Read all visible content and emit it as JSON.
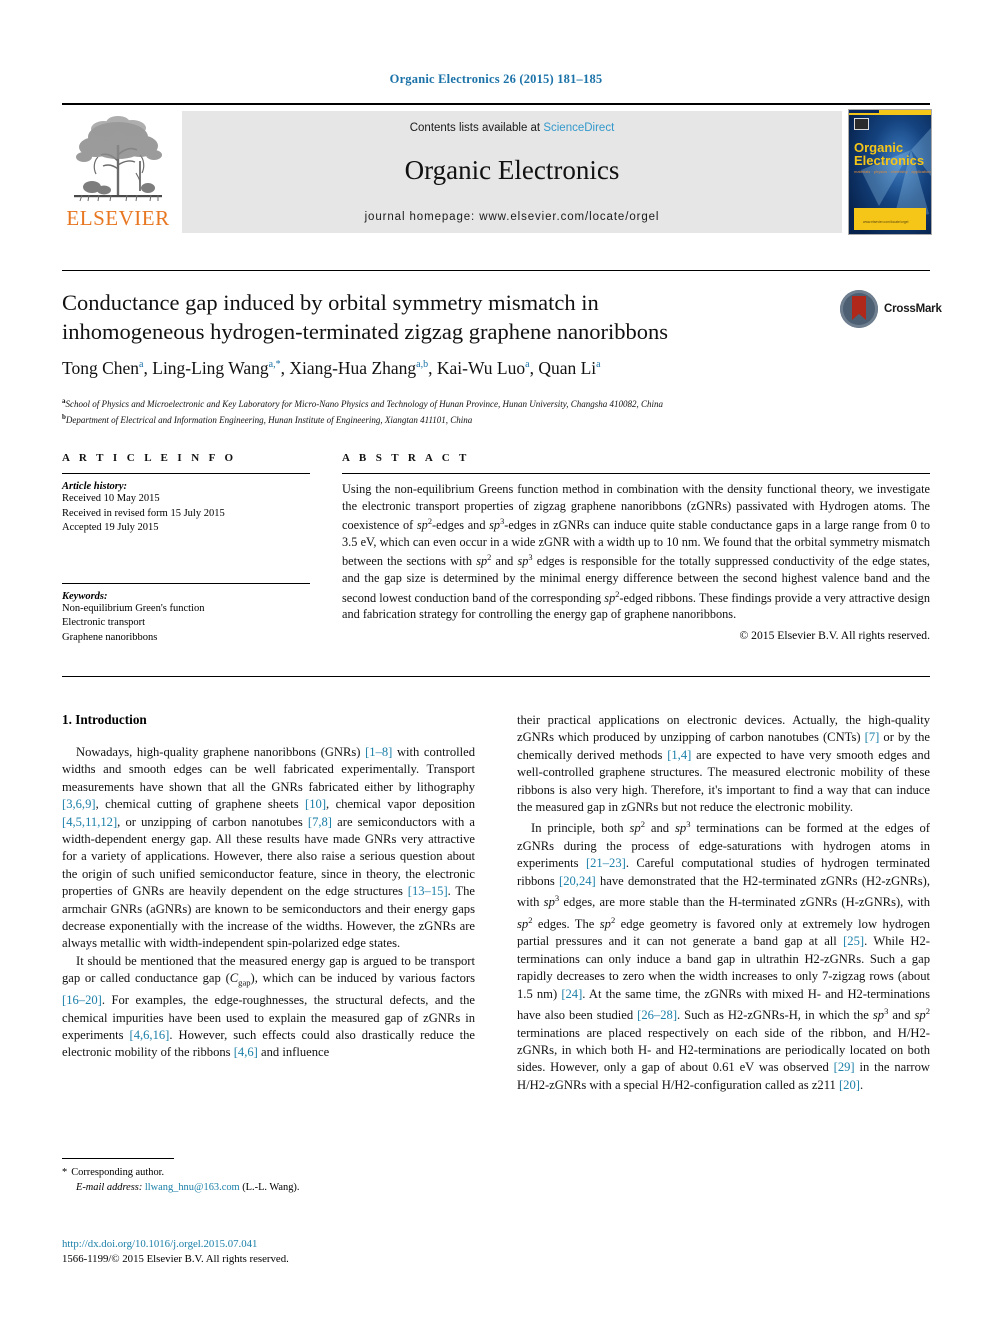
{
  "running_head": "Organic Electronics 26 (2015) 181–185",
  "journal_header": {
    "contents_prefix": "Contents lists available at ",
    "sciencedirect": "ScienceDirect",
    "journal_title": "Organic Electronics",
    "homepage": "journal homepage: www.elsevier.com/locate/orgel",
    "publisher_logo_text": "ELSEVIER",
    "cover_title_line1": "Organic",
    "cover_title_line2": "Electronics",
    "cover_subtitle": "materials • physics • chemistry • applications"
  },
  "crossmark": {
    "label": "CrossMark"
  },
  "article": {
    "title_line1": "Conductance gap induced by orbital symmetry mismatch in",
    "title_line2": "inhomogeneous hydrogen-terminated zigzag graphene nanoribbons",
    "authors": [
      {
        "name": "Tong Chen",
        "marks": "a"
      },
      {
        "name": "Ling-Ling Wang",
        "marks": "a,*"
      },
      {
        "name": "Xiang-Hua Zhang",
        "marks": "a,b"
      },
      {
        "name": "Kai-Wu Luo",
        "marks": "a"
      },
      {
        "name": "Quan Li",
        "marks": "a"
      }
    ],
    "affiliations": [
      {
        "mark": "a",
        "text": "School of Physics and Microelectronic and Key Laboratory for Micro-Nano Physics and Technology of Hunan Province, Hunan University, Changsha 410082, China"
      },
      {
        "mark": "b",
        "text": "Department of Electrical and Information Engineering, Hunan Institute of Engineering, Xiangtan 411101, China"
      }
    ]
  },
  "article_info": {
    "heading": "A R T I C L E   I N F O",
    "history_label": "Article history:",
    "history": [
      "Received 10 May 2015",
      "Received in revised form 15 July 2015",
      "Accepted 19 July 2015"
    ],
    "keywords_label": "Keywords:",
    "keywords": [
      "Non-equilibrium Green's function",
      "Electronic transport",
      "Graphene nanoribbons"
    ]
  },
  "abstract": {
    "heading": "A B S T R A C T",
    "text": "Using the non-equilibrium Greens function method in combination with the density functional theory, we investigate the electronic transport properties of zigzag graphene nanoribbons (zGNRs) passivated with Hydrogen atoms. The coexistence of sp2-edges and sp3-edges in zGNRs can induce quite stable conductance gaps in a large range from 0 to 3.5 eV, which can even occur in a wide zGNR with a width up to 10 nm. We found that the orbital symmetry mismatch between the sections with sp2 and sp3 edges is responsible for the totally suppressed conductivity of the edge states, and the gap size is determined by the minimal energy difference between the second highest valence band and the second lowest conduction band of the corresponding sp2-edged ribbons. These findings provide a very attractive design and fabrication strategy for controlling the energy gap of graphene nanoribbons.",
    "copyright": "© 2015 Elsevier B.V. All rights reserved."
  },
  "body": {
    "section_heading": "1. Introduction",
    "left_paragraphs": [
      "Nowadays, high-quality graphene nanoribbons (GNRs) [1–8] with controlled widths and smooth edges can be well fabricated experimentally. Transport measurements have shown that all the GNRs fabricated either by lithography [3,6,9], chemical cutting of graphene sheets [10], chemical vapor deposition [4,5,11,12], or unzipping of carbon nanotubes [7,8] are semiconductors with a width-dependent energy gap. All these results have made GNRs very attractive for a variety of applications. However, there also raise a serious question about the origin of such unified semiconductor feature, since in theory, the electronic properties of GNRs are heavily dependent on the edge structures [13–15]. The armchair GNRs (aGNRs) are known to be semiconductors and their energy gaps decrease exponentially with the increase of the widths. However, the zGNRs are always metallic with width-independent spin-polarized edge states.",
      "It should be mentioned that the measured energy gap is argued to be transport gap or called conductance gap (Cgap), which can be induced by various factors [16–20]. For examples, the edge-roughnesses, the structural defects, and the chemical impurities have been used to explain the measured gap of zGNRs in experiments [4,6,16]. However, such effects could also drastically reduce the electronic mobility of the ribbons [4,6] and influence"
    ],
    "right_paragraphs": [
      "their practical applications on electronic devices. Actually, the high-quality zGNRs which produced by unzipping of carbon nanotubes (CNTs) [7] or by the chemically derived methods [1,4] are expected to have very smooth edges and well-controlled graphene structures. The measured electronic mobility of these ribbons is also very high. Therefore, it's important to find a way that can induce the measured gap in zGNRs but not reduce the electronic mobility.",
      "In principle, both sp2 and sp3 terminations can be formed at the edges of zGNRs during the process of edge-saturations with hydrogen atoms in experiments [21–23]. Careful computational studies of hydrogen terminated ribbons [20,24] have demonstrated that the H2-terminated zGNRs (H2-zGNRs), with sp3 edges, are more stable than the H-terminated zGNRs (H-zGNRs), with sp2 edges. The sp2 edge geometry is favored only at extremely low hydrogen partial pressures and it can not generate a band gap at all [25]. While H2-terminations can only induce a band gap in ultrathin H2-zGNRs. Such a gap rapidly decreases to zero when the width increases to only 7-zigzag rows (about 1.5 nm) [24]. At the same time, the zGNRs with mixed H- and H2-terminations have also been studied [26–28]. Such as H2-zGNRs-H, in which the sp3 and sp2 terminations are placed respectively on each side of the ribbon, and H/H2-zGNRs, in which both H- and H2-terminations are periodically located on both sides. However, only a gap of about 0.61 eV was observed [29] in the narrow H/H2-zGNRs with a special H/H2-configuration called as z211 [20]."
    ]
  },
  "footnote": {
    "star": "*",
    "corresponding": "Corresponding author.",
    "email_label": "E-mail address:",
    "email": "llwang_hnu@163.com",
    "email_owner": "(L.-L. Wang)."
  },
  "doi_block": {
    "doi": "http://dx.doi.org/10.1016/j.orgel.2015.07.041",
    "issn_line": "1566-1199/© 2015 Elsevier B.V. All rights reserved."
  },
  "colors": {
    "link": "#1b7fa8",
    "runhead": "#1b72a8",
    "elsevier_orange": "#e87722",
    "sciencedirect": "#3399cc",
    "band_gray": "#e6e6e6",
    "cover_blue": "#0b2a5b",
    "cover_yellow": "#f5c518",
    "crossmark_red": "#b0281a"
  }
}
